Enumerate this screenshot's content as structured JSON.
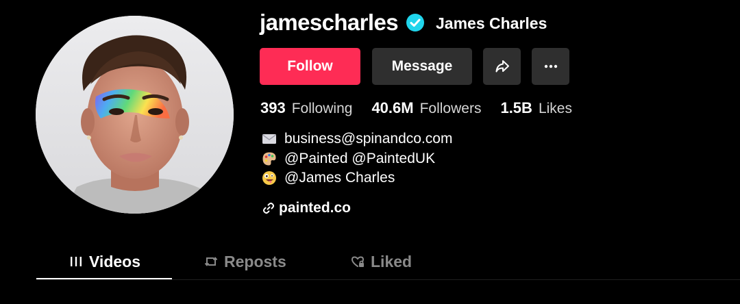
{
  "profile": {
    "username": "jamescharles",
    "display_name": "James Charles",
    "verified": true,
    "accent_color": "#fe2c55",
    "verified_color": "#20d5ec"
  },
  "actions": {
    "follow_label": "Follow",
    "message_label": "Message",
    "share_icon": "share-arrow-icon",
    "more_icon": "more-dots-icon"
  },
  "stats": [
    {
      "value": "393",
      "label": "Following"
    },
    {
      "value": "40.6M",
      "label": "Followers"
    },
    {
      "value": "1.5B",
      "label": "Likes"
    }
  ],
  "bio": {
    "lines": [
      {
        "icon": "envelope-emoji",
        "text": "business@spinandco.com"
      },
      {
        "icon": "palette-emoji",
        "text": "@Painted @PaintedUK"
      },
      {
        "icon": "zany-face-emoji",
        "text": "@James Charles"
      }
    ],
    "link": "painted.co"
  },
  "tabs": [
    {
      "label": "Videos",
      "icon": "grid-icon",
      "active": true
    },
    {
      "label": "Reposts",
      "icon": "repost-icon",
      "active": false
    },
    {
      "label": "Liked",
      "icon": "heart-lock-icon",
      "active": false
    }
  ]
}
